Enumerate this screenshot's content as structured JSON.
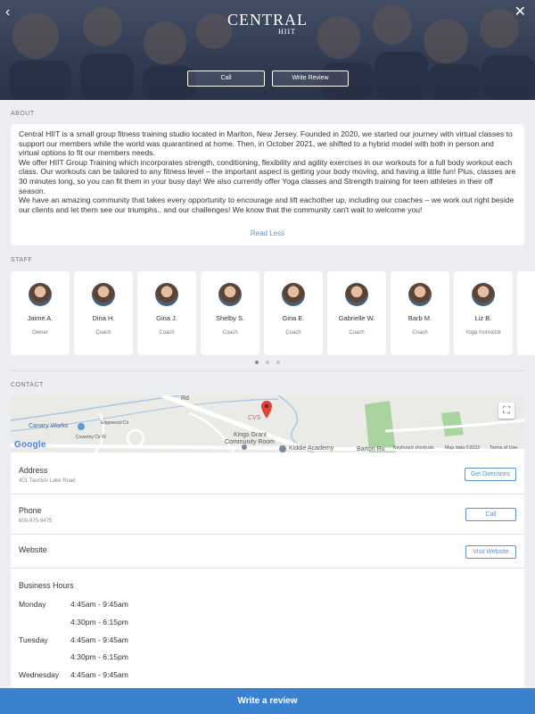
{
  "header": {
    "logo_main": "CENTRAL",
    "logo_sub": "HIIT",
    "buttons": {
      "call": "Call",
      "write_review": "Write Review"
    },
    "icons": {
      "back": "back-chevron-icon",
      "close": "close-icon"
    }
  },
  "about": {
    "label": "ABOUT",
    "paragraphs": [
      "Central HIIT is a small group fitness training studio located in Marlton, New Jersey.  Founded in 2020, we started our journey with virtual classes to support our members while the world was quarantined at home.  Then, in October 2021, we shifted to a hybrid model with both in person and virtual options to fit our members needs.",
      "We offer HIIT Group Training which incorporates strength, conditioning, flexibility and agility exercises in our workouts for a full body workout each class. Our workouts can be tailored to any fitness level – the important aspect is getting your body moving, and having a little fun! Plus, classes are 30 minutes long, so you can fit them in your busy day!  We also currently offer Yoga classes and Strength training for teen athletes in their off season.",
      "We have an amazing community that takes every opportunity to encourage and lift eachother up, including our coaches – we work out right beside our clients and let them see our triumphs.. and our challenges!  We know that the community can't wait to welcome you!"
    ],
    "read_less": "Read Less"
  },
  "staff": {
    "label": "STAFF",
    "members": [
      {
        "name": "Jaime A.",
        "role": "Owner"
      },
      {
        "name": "Dina H.",
        "role": "Coach"
      },
      {
        "name": "Gina J.",
        "role": "Coach"
      },
      {
        "name": "Shelby S.",
        "role": "Coach"
      },
      {
        "name": "Gina E.",
        "role": "Coach"
      },
      {
        "name": "Gabrielle W.",
        "role": "Coach"
      },
      {
        "name": "Barb M.",
        "role": "Coach"
      },
      {
        "name": "Liz B.",
        "role": "Yoga Instructor"
      }
    ],
    "pages": 3,
    "active_page": 1
  },
  "contact": {
    "label": "CONTACT",
    "map": {
      "labels": {
        "cvs": "CVS",
        "canary": "Canary Works",
        "kings_grant": "Kings Grant",
        "community_room": "Community Room",
        "kiddie": "Kiddie Academy",
        "barton": "Barton Ru",
        "road_rd": "Rd",
        "road_edgewood": "Edgewood Cir",
        "road_coventry": "Coventry Cir W"
      },
      "google": "Google",
      "footer": {
        "shortcuts": "Keyboard shortcuts",
        "mapdata": "Map data ©2022",
        "terms": "Terms of Use"
      }
    },
    "address": {
      "title": "Address",
      "value": "401 Taunton Lake Road",
      "button": "Get Directions"
    },
    "phone": {
      "title": "Phone",
      "value": "609-975-9475",
      "button": "Call"
    },
    "website": {
      "title": "Website",
      "button": "Visit Website"
    },
    "hours": {
      "title": "Business Hours",
      "rows": [
        {
          "day": "Monday",
          "time": "4:45am - 9:45am"
        },
        {
          "day": "",
          "time": "4:30pm - 6:15pm"
        },
        {
          "day": "Tuesday",
          "time": "4:45am - 9:45am"
        },
        {
          "day": "",
          "time": "4:30pm - 6:15pm"
        },
        {
          "day": "Wednesday",
          "time": "4:45am - 9:45am"
        }
      ]
    }
  },
  "footer": {
    "write_review": "Write a review"
  },
  "colors": {
    "accent": "#3a82d0",
    "link": "#5a93c8",
    "pin": "#e0433a",
    "background": "#eceef1"
  }
}
